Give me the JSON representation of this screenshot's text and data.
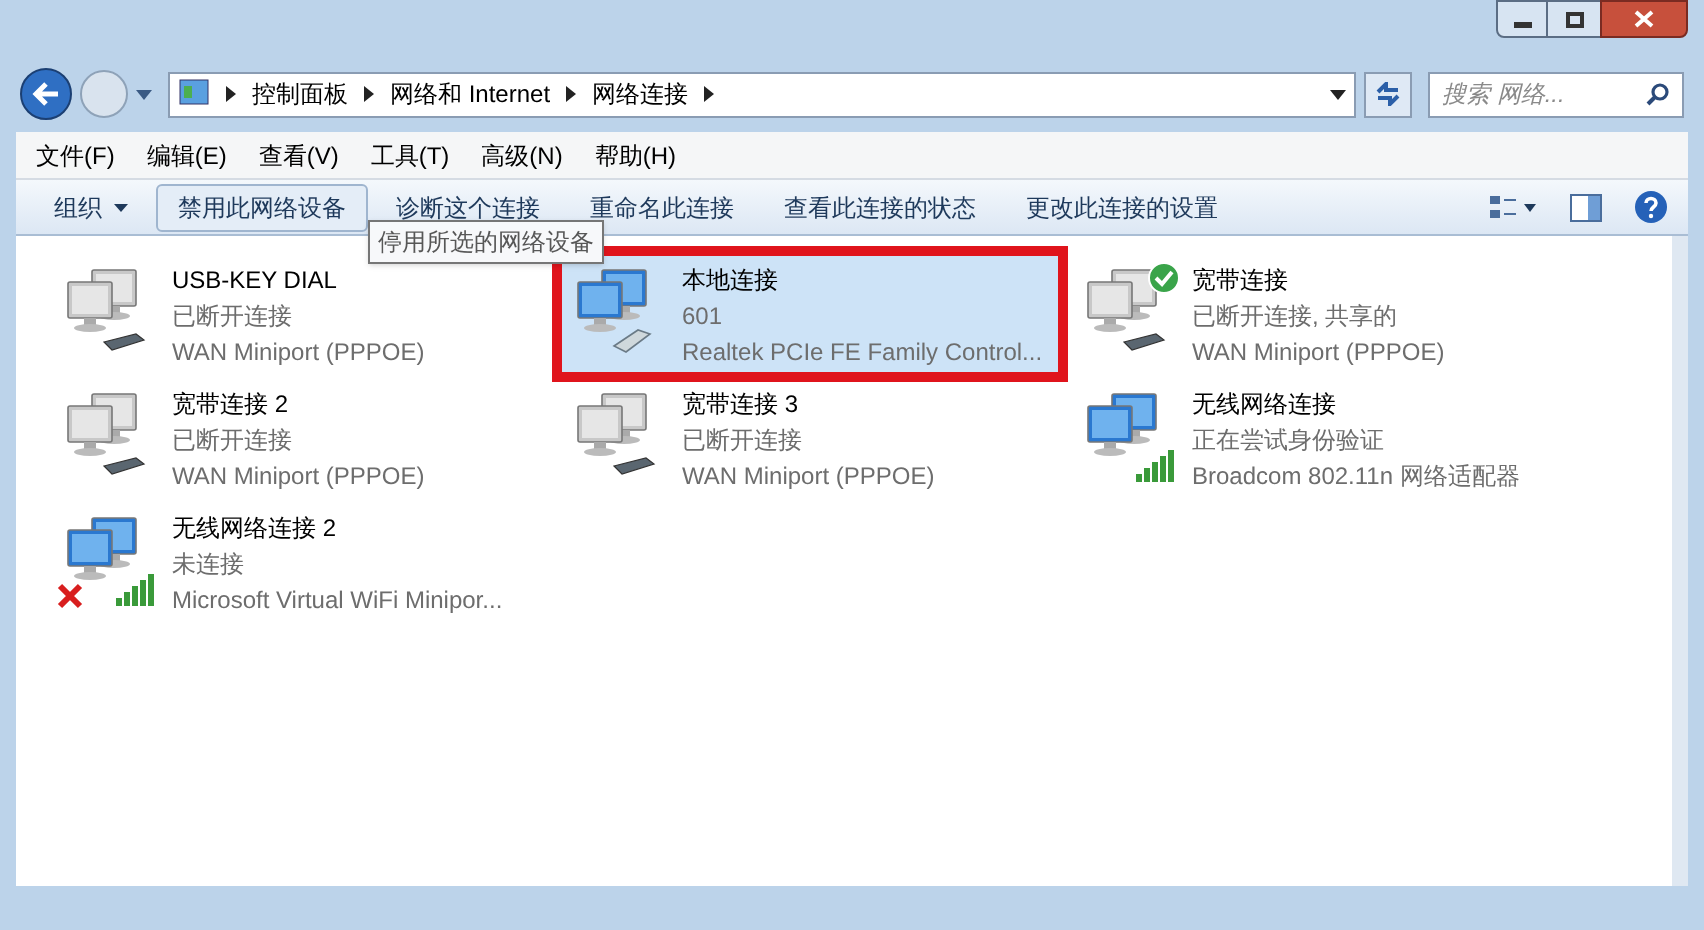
{
  "address_bar": {
    "path": [
      "控制面板",
      "网络和 Internet",
      "网络连接"
    ]
  },
  "search": {
    "placeholder": "搜索 网络..."
  },
  "menu_bar": [
    "文件(F)",
    "编辑(E)",
    "查看(V)",
    "工具(T)",
    "高级(N)",
    "帮助(H)"
  ],
  "toolbar": [
    {
      "label": "组织",
      "kind": "dropdown",
      "pressed": false
    },
    {
      "label": "禁用此网络设备",
      "kind": "button",
      "pressed": true
    },
    {
      "label": "诊断这个连接",
      "kind": "button",
      "pressed": false
    },
    {
      "label": "重命名此连接",
      "kind": "button",
      "pressed": false
    },
    {
      "label": "查看此连接的状态",
      "kind": "button",
      "pressed": false
    },
    {
      "label": "更改此连接的设置",
      "kind": "button",
      "pressed": false
    }
  ],
  "tooltip": "停用所选的网络设备",
  "connections": [
    {
      "name": "USB-KEY DIAL",
      "status": "已断开连接",
      "device": "WAN Miniport (PPPOE)",
      "kind": "wan",
      "ok_badge": false,
      "error_badge": false,
      "selected": false,
      "outlined": false
    },
    {
      "name": "本地连接",
      "status": "601",
      "device": "Realtek PCIe FE Family Control...",
      "kind": "lan",
      "ok_badge": false,
      "error_badge": false,
      "selected": true,
      "outlined": true
    },
    {
      "name": "宽带连接",
      "status": "已断开连接, 共享的",
      "device": "WAN Miniport (PPPOE)",
      "kind": "wan",
      "ok_badge": true,
      "error_badge": false,
      "selected": false,
      "outlined": false
    },
    {
      "name": "宽带连接 2",
      "status": "已断开连接",
      "device": "WAN Miniport (PPPOE)",
      "kind": "wan",
      "ok_badge": false,
      "error_badge": false,
      "selected": false,
      "outlined": false
    },
    {
      "name": "宽带连接 3",
      "status": "已断开连接",
      "device": "WAN Miniport (PPPOE)",
      "kind": "wan",
      "ok_badge": false,
      "error_badge": false,
      "selected": false,
      "outlined": false
    },
    {
      "name": "无线网络连接",
      "status": "正在尝试身份验证",
      "device": "Broadcom 802.11n 网络适配器",
      "kind": "wifi",
      "ok_badge": false,
      "error_badge": false,
      "selected": false,
      "outlined": false
    },
    {
      "name": "无线网络连接 2",
      "status": "未连接",
      "device": "Microsoft Virtual WiFi Minipor...",
      "kind": "wifi",
      "ok_badge": false,
      "error_badge": true,
      "selected": false,
      "outlined": false
    }
  ]
}
